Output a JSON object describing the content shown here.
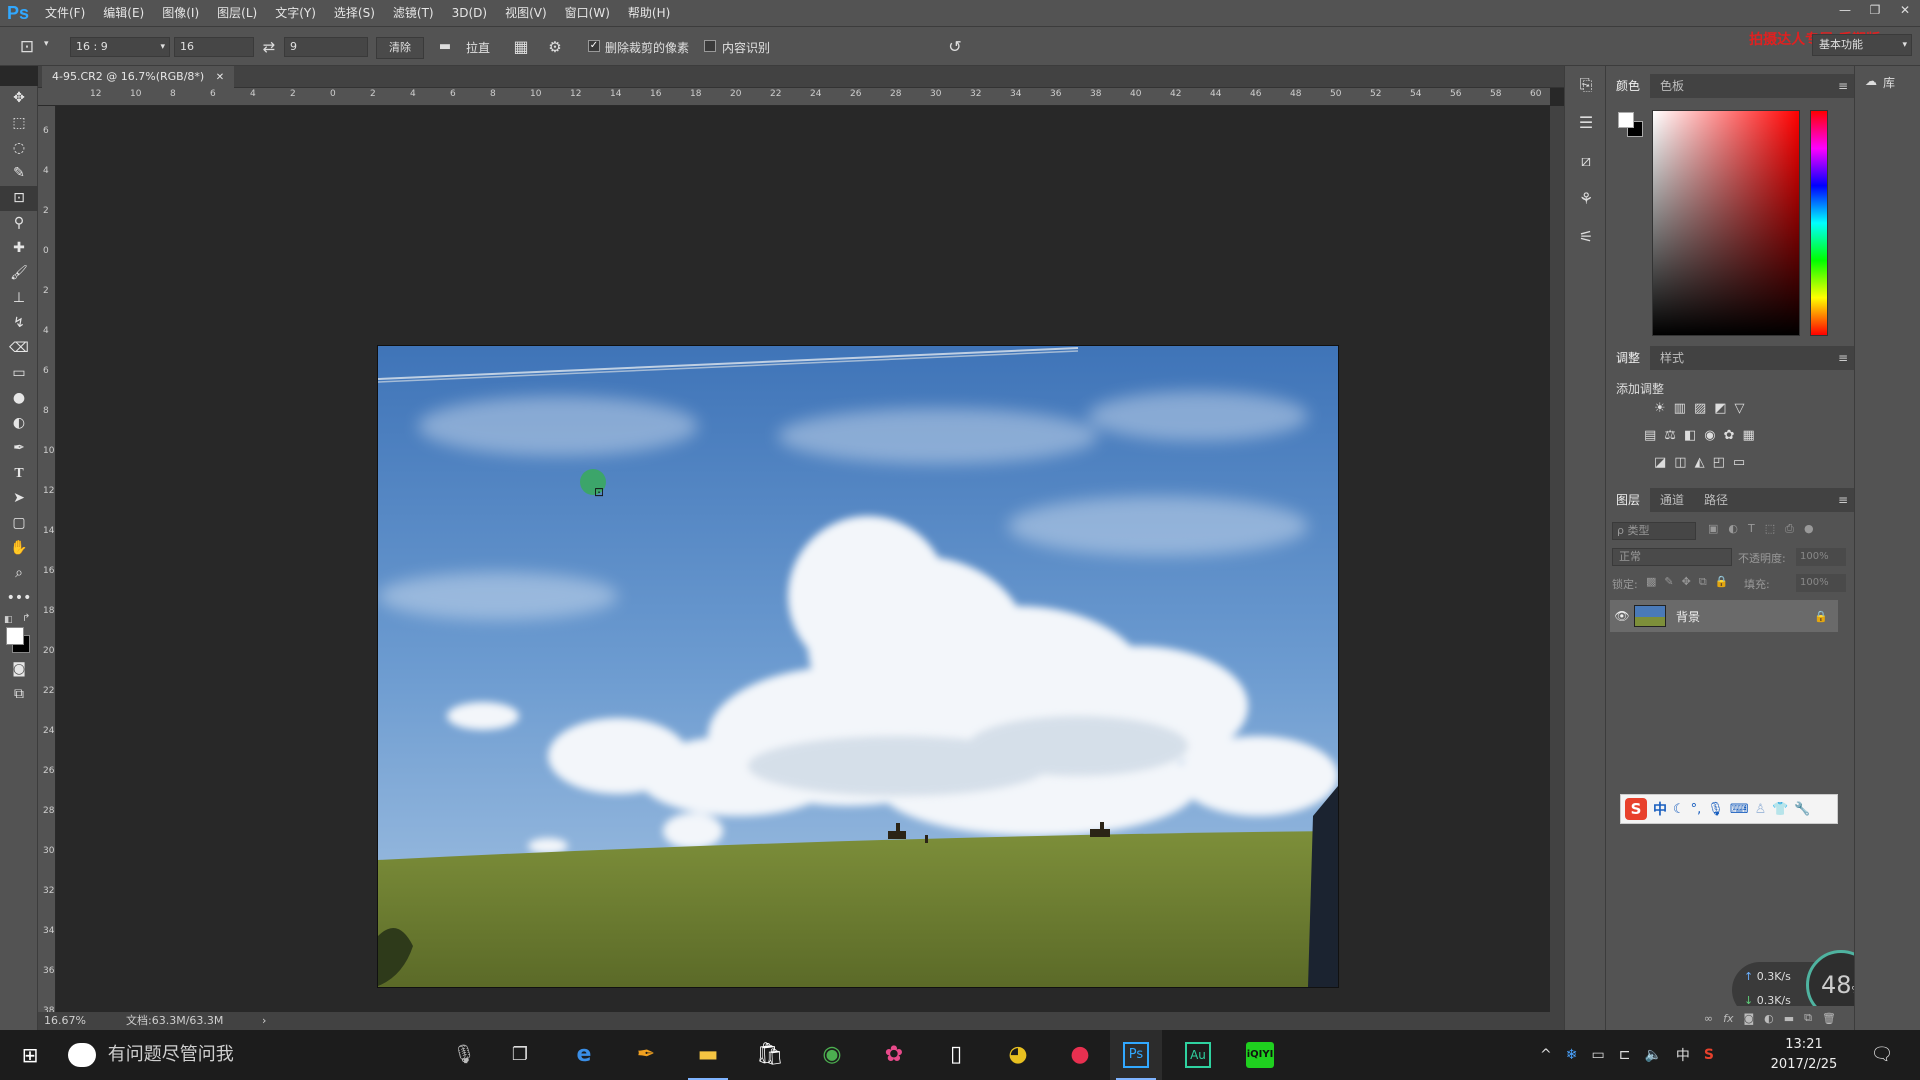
{
  "menubar": {
    "logo": "Ps",
    "items": [
      "文件(F)",
      "编辑(E)",
      "图像(I)",
      "图层(L)",
      "文字(Y)",
      "选择(S)",
      "滤镜(T)",
      "3D(D)",
      "视图(V)",
      "窗口(W)",
      "帮助(H)"
    ],
    "window_controls": [
      "—",
      "❐",
      "✕"
    ]
  },
  "options": {
    "ratio_preset": "16 : 9",
    "width_value": "16",
    "height_value": "9",
    "clear_label": "清除",
    "straighten_label": "拉直",
    "delete_cropped_label": "删除裁剪的像素",
    "delete_cropped_checked": true,
    "content_aware_label": "内容识别",
    "content_aware_checked": false,
    "watermark": "拍摄达人专属 后期版",
    "workspace": "基本功能"
  },
  "document": {
    "tab_title": "4-95.CR2 @ 16.7%(RGB/8*)",
    "zoom": "16.67%",
    "doc_size": "文档:63.3M/63.3M"
  },
  "ruler": {
    "top_ticks": [
      "12",
      "10",
      "8",
      "6",
      "4",
      "2",
      "0",
      "2",
      "4",
      "6",
      "8",
      "10",
      "12",
      "14",
      "16",
      "18",
      "20",
      "22",
      "24",
      "26",
      "28",
      "30",
      "32",
      "34",
      "36",
      "38",
      "40",
      "42",
      "44",
      "46",
      "48",
      "50",
      "52",
      "54",
      "56",
      "58",
      "60"
    ],
    "left_ticks": [
      "6",
      "4",
      "2",
      "0",
      "2",
      "4",
      "6",
      "8",
      "10",
      "12",
      "14",
      "16",
      "18",
      "20",
      "22",
      "24",
      "26",
      "28",
      "30",
      "32",
      "34",
      "36",
      "38"
    ]
  },
  "panels": {
    "color_tabs": [
      "颜色",
      "色板"
    ],
    "adjust_tabs": [
      "调整",
      "样式"
    ],
    "add_adjustment": "添加调整",
    "layers_tabs": [
      "图层",
      "通道",
      "路径"
    ],
    "filter_kind": "ρ 类型",
    "blend_mode": "正常",
    "opacity_label": "不透明度:",
    "opacity_value": "100%",
    "lock_label": "锁定:",
    "fill_label": "填充:",
    "fill_value": "100%",
    "layer_name": "背景",
    "library_label": "库"
  },
  "ime": {
    "lang": "中"
  },
  "netmon": {
    "up": "0.3K/s",
    "down": "0.3K/s",
    "percent": "48",
    "percent_unit": "%"
  },
  "taskbar": {
    "search_placeholder": "有问题尽管问我",
    "time": "13:21",
    "date": "2017/2/25",
    "ime_lang": "中"
  },
  "colors": {
    "accent": "#31a8ff",
    "panel_bg": "#535353",
    "canvas_bg": "#282828",
    "watermark": "#e02020"
  }
}
